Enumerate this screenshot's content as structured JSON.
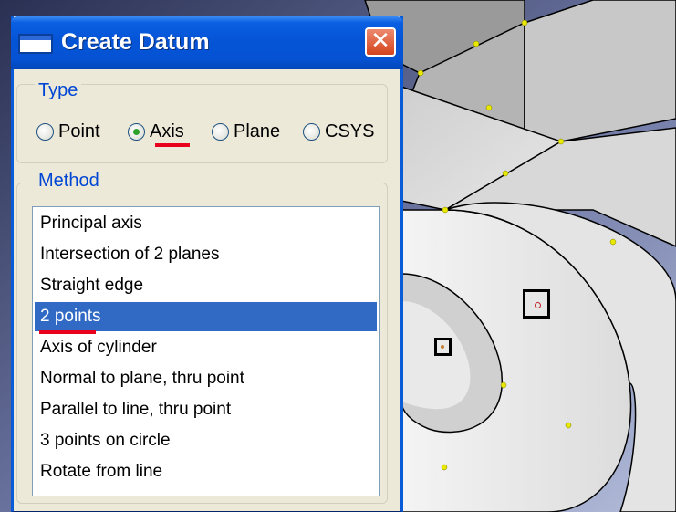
{
  "dialog": {
    "title": "Create Datum",
    "close_glyph": "✕",
    "type_group": {
      "label": "Type",
      "options": [
        {
          "label": "Point",
          "selected": false
        },
        {
          "label": "Axis",
          "selected": true
        },
        {
          "label": "Plane",
          "selected": false
        },
        {
          "label": "CSYS",
          "selected": false
        }
      ]
    },
    "method_group": {
      "label": "Method",
      "items": [
        {
          "label": "Principal axis",
          "selected": false
        },
        {
          "label": "Intersection of 2 planes",
          "selected": false
        },
        {
          "label": "Straight edge",
          "selected": false
        },
        {
          "label": "2 points",
          "selected": true
        },
        {
          "label": "Axis of cylinder",
          "selected": false
        },
        {
          "label": "Normal to plane, thru point",
          "selected": false
        },
        {
          "label": "Parallel to line, thru point",
          "selected": false
        },
        {
          "label": "3 points on circle",
          "selected": false
        },
        {
          "label": "Rotate from line",
          "selected": false
        }
      ]
    }
  },
  "colors": {
    "titlebar": "#0554d6",
    "selection": "#316ac5",
    "group_label": "#0046d5",
    "annotation_underline": "#e8001c",
    "vertex_marker": "#e8e800"
  },
  "icons": {
    "app": "window-icon",
    "close": "close-icon"
  }
}
